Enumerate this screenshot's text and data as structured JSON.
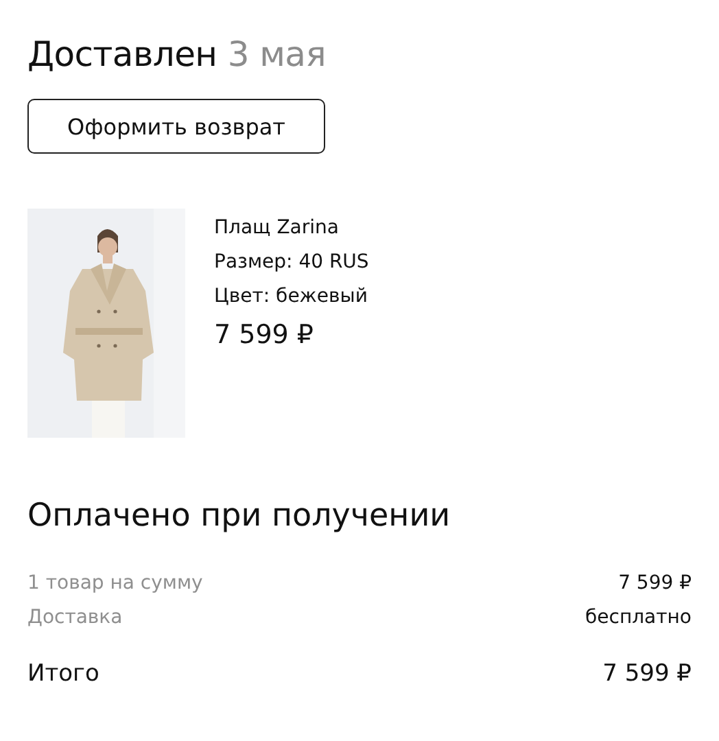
{
  "status": {
    "title": "Доставлен",
    "date": "3 мая"
  },
  "return_button": "Оформить возврат",
  "product": {
    "name": "Плащ Zarina",
    "size": "Размер: 40 RUS",
    "colour_line": "Цвет: бежевый",
    "price": "7 599 ₽"
  },
  "payment": {
    "title": "Оплачено при получении",
    "rows": [
      {
        "label": "1 товар на сумму",
        "value": "7 599 ₽"
      },
      {
        "label": "Доставка",
        "value": "бесплатно"
      }
    ],
    "total": {
      "label": "Итого",
      "value": "7 599 ₽"
    }
  }
}
